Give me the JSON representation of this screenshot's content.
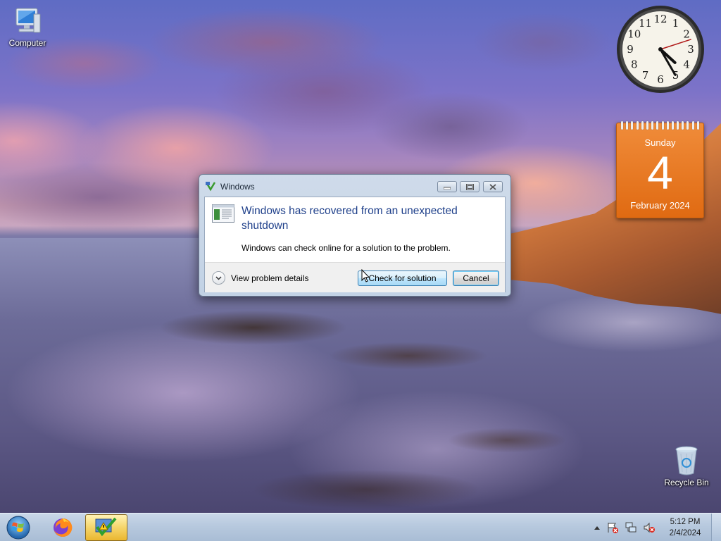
{
  "desktop": {
    "icons": [
      {
        "label": "Computer",
        "icon": "computer-icon"
      },
      {
        "label": "Recycle Bin",
        "icon": "recycle-bin-icon"
      }
    ]
  },
  "gadgets": {
    "clock": {
      "hour": 4,
      "minute": 25,
      "second": 12,
      "numerals": [
        "12",
        "1",
        "2",
        "3",
        "4",
        "5",
        "6",
        "7",
        "8",
        "9",
        "10",
        "11"
      ]
    },
    "calendar": {
      "weekday": "Sunday",
      "day": "4",
      "month_year": "February 2024",
      "color": "#e8741c"
    }
  },
  "dialog": {
    "title": "Windows",
    "main_instruction": "Windows has recovered from an unexpected shutdown",
    "content": "Windows can check online for a solution to the problem.",
    "details_label": "View problem details",
    "buttons": {
      "primary": "Check for solution",
      "cancel": "Cancel"
    },
    "caption_buttons": [
      "minimize",
      "restore",
      "close"
    ],
    "accent": "#1e3f8a"
  },
  "taskbar": {
    "items": [
      {
        "name": "start-button",
        "icon": "windows-orb-icon"
      },
      {
        "name": "firefox",
        "icon": "firefox-icon"
      },
      {
        "name": "windows-problem-reporting",
        "icon": "problem-report-icon",
        "active": true
      }
    ],
    "tray": {
      "icons": [
        "show-hidden-icons-icon",
        "action-center-icon",
        "network-icon",
        "volume-muted-icon"
      ],
      "time": "5:12 PM",
      "date": "2/4/2024"
    }
  }
}
